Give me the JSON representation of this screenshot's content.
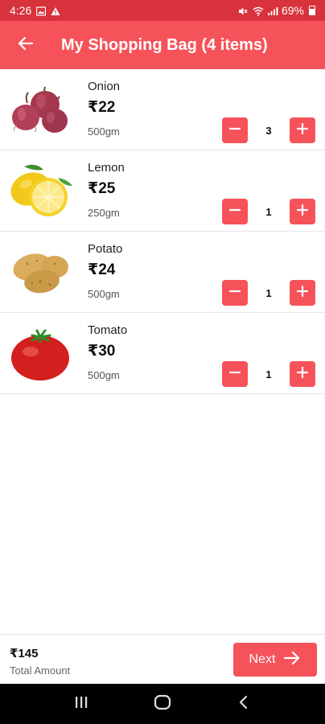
{
  "status_bar": {
    "time": "4:26",
    "battery": "69%",
    "icons": [
      "image-icon",
      "alert-icon",
      "mute-icon",
      "wifi-icon",
      "signal-icon",
      "battery-icon"
    ]
  },
  "app_bar": {
    "title": "My Shopping Bag (4 items)",
    "back_icon": "arrow-left-icon"
  },
  "items": [
    {
      "name": "Onion",
      "price": "₹22",
      "weight": "500gm",
      "qty": "3",
      "image": "onion"
    },
    {
      "name": "Lemon",
      "price": "₹25",
      "weight": "250gm",
      "qty": "1",
      "image": "lemon"
    },
    {
      "name": "Potato",
      "price": "₹24",
      "weight": "500gm",
      "qty": "1",
      "image": "potato"
    },
    {
      "name": "Tomato",
      "price": "₹30",
      "weight": "500gm",
      "qty": "1",
      "image": "tomato"
    }
  ],
  "footer": {
    "total_amount": "₹145",
    "total_label": "Total Amount",
    "next_label": "Next"
  },
  "nav": {
    "icons": [
      "recents-icon",
      "home-icon",
      "back-icon"
    ]
  },
  "colors": {
    "primary": "#f6525a",
    "status_bar": "#d8323c",
    "nav_bar": "#000000"
  }
}
